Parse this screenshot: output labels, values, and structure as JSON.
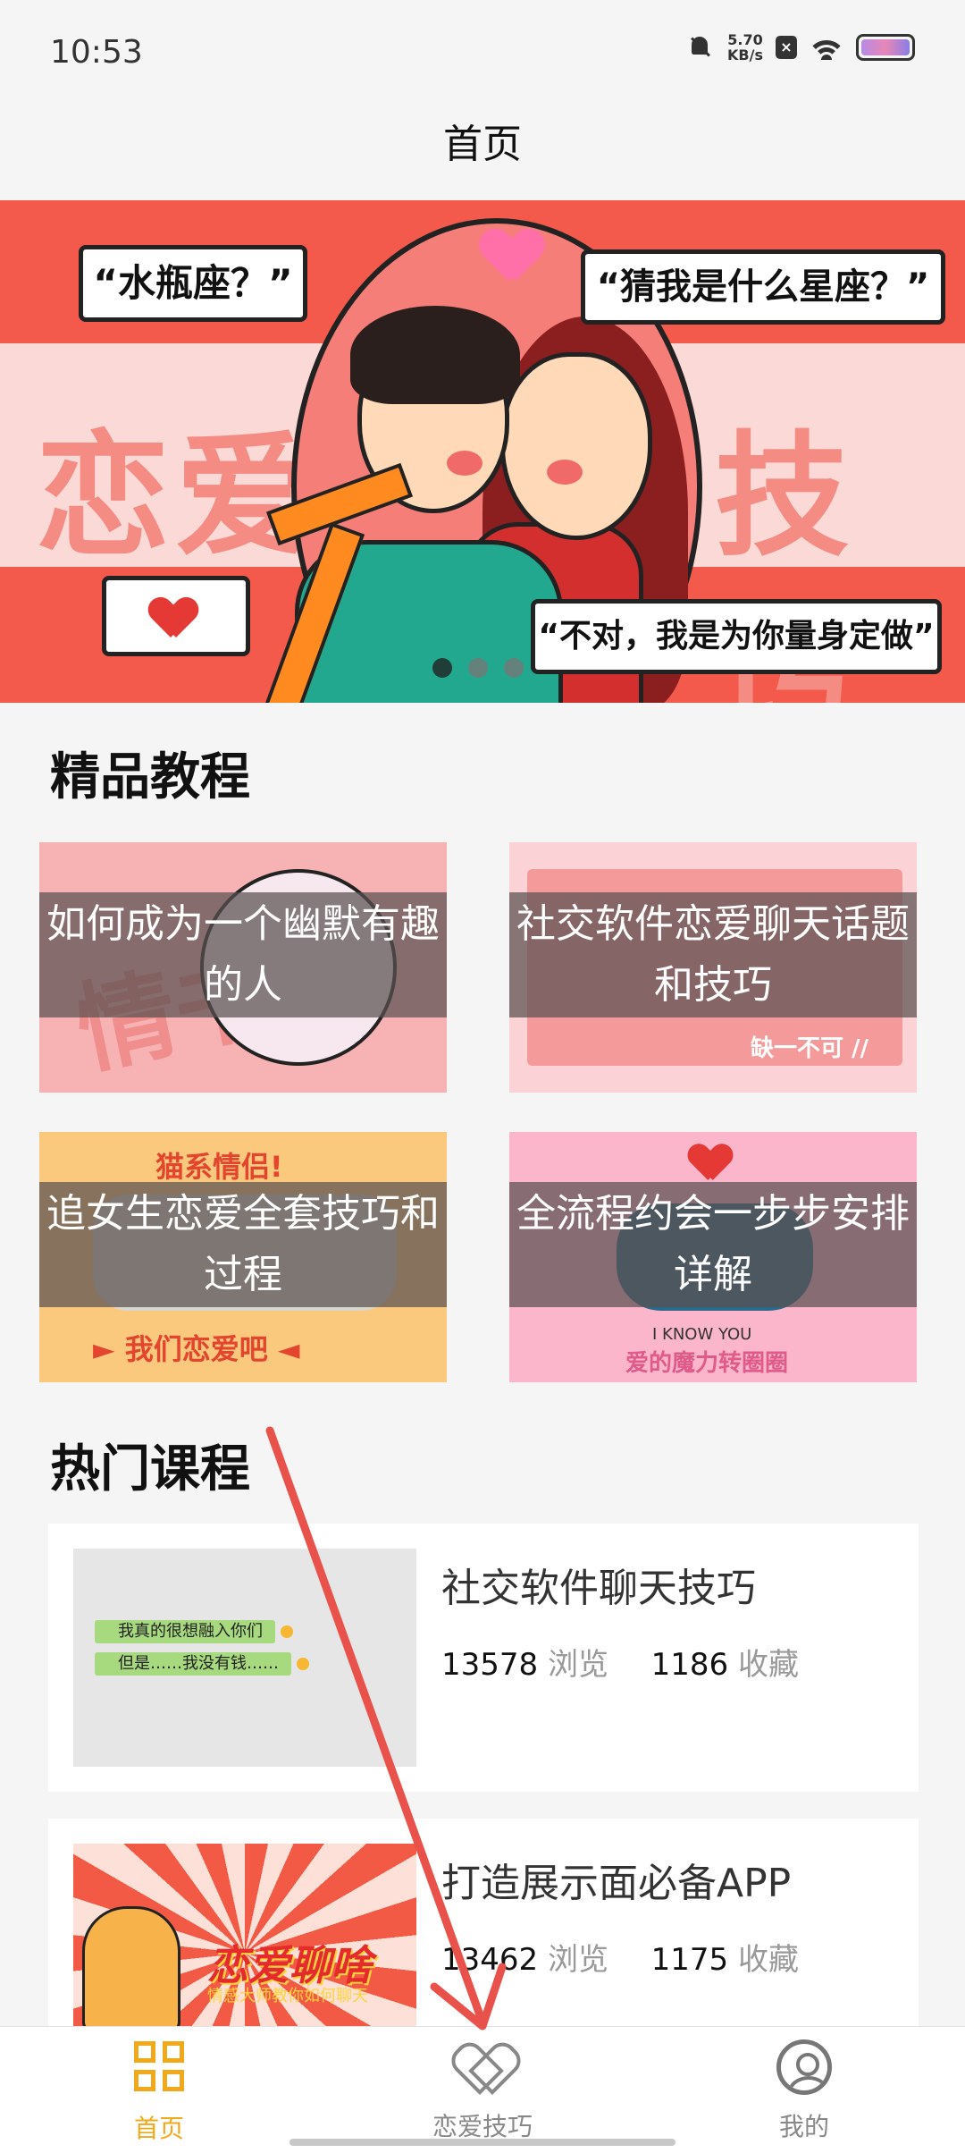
{
  "status_bar": {
    "time": "10:53",
    "network_speed_value": "5.70",
    "network_speed_unit": "KB/s",
    "icons": [
      "mute-bell-icon",
      "close-box-icon",
      "wifi-icon",
      "battery-icon"
    ]
  },
  "header": {
    "title": "首页"
  },
  "banner": {
    "bubble_left": "“水瓶座？”",
    "bubble_right": "“猜我是什么星座？”",
    "bubble_bottom": "“不对，我是为你量身定做”",
    "word_left": "恋爱",
    "word_right": "技巧",
    "slide_count": 3,
    "active_slide": 1
  },
  "tutorials": {
    "heading": "精品教程",
    "items": [
      {
        "title": "如何成为一个幽默有趣的人",
        "deco": "情书"
      },
      {
        "title": "社交软件恋爱聊天话题和技巧",
        "deco": "缺一不可 //"
      },
      {
        "title": "追女生恋爱全套技巧和过程",
        "deco_top": "猫系情侣!",
        "deco_bottom": "► 我们恋爱吧 ◄"
      },
      {
        "title": "全流程约会一步步安排详解",
        "deco_top": "I KNOW YOU",
        "deco_bottom": "爱的魔力转圈圈"
      }
    ]
  },
  "courses": {
    "heading": "热门课程",
    "items": [
      {
        "title": "社交软件聊天技巧",
        "views": "13578",
        "views_label": "浏览",
        "favorites": "1186",
        "favorites_label": "收藏",
        "thumb_line1": "我真的很想融入你们",
        "thumb_line2": "但是……我没有钱……"
      },
      {
        "title": "打造展示面必备APP",
        "views": "13462",
        "views_label": "浏览",
        "favorites": "1175",
        "favorites_label": "收藏",
        "thumb_title": "恋爱聊啥",
        "thumb_sub": "情感大师教你如何聊天"
      }
    ]
  },
  "bottom_nav": {
    "items": [
      {
        "label": "首页",
        "icon": "grid-icon",
        "active": true
      },
      {
        "label": "恋爱技巧",
        "icon": "heart-outline-icon",
        "active": false
      },
      {
        "label": "我的",
        "icon": "user-circle-icon",
        "active": false
      }
    ],
    "active_color": "#f0a91a",
    "inactive_color": "#888888"
  },
  "colors": {
    "banner_red": "#f35a4c",
    "annotation_arrow": "#e8524a"
  }
}
